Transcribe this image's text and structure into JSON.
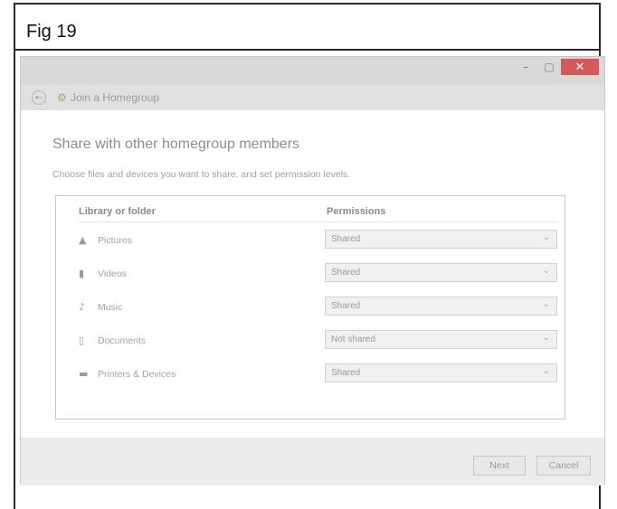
{
  "figure": {
    "caption": "Fig 19"
  },
  "window": {
    "controls": {
      "minimize": "–",
      "maximize": "▢",
      "close": "✕"
    }
  },
  "nav": {
    "back_icon": "back-arrow-icon",
    "title": "Join a Homegroup"
  },
  "content": {
    "heading": "Share with other homegroup members",
    "subtext": "Choose files and devices you want to share, and set permission levels.",
    "columns": {
      "library": "Library or folder",
      "permissions": "Permissions"
    },
    "rows": [
      {
        "icon": "pictures-icon",
        "label": "Pictures",
        "permission": "Shared"
      },
      {
        "icon": "videos-icon",
        "label": "Videos",
        "permission": "Shared"
      },
      {
        "icon": "music-icon",
        "label": "Music",
        "permission": "Shared"
      },
      {
        "icon": "documents-icon",
        "label": "Documents",
        "permission": "Not shared"
      },
      {
        "icon": "printer-icon",
        "label": "Printers & Devices",
        "permission": "Shared"
      }
    ]
  },
  "footer": {
    "next_label": "Next",
    "cancel_label": "Cancel"
  },
  "colors": {
    "close_button": "#d45a5a",
    "window_bg": "#ececec",
    "content_bg": "#ffffff"
  }
}
